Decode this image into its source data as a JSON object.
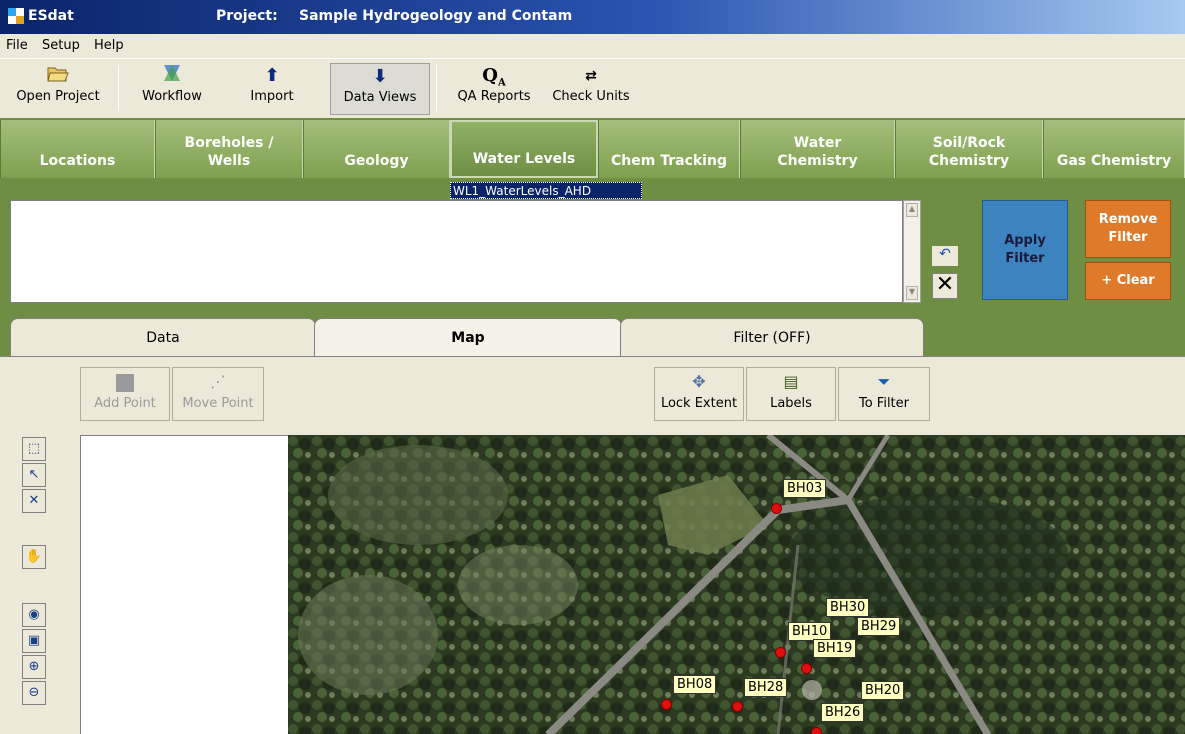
{
  "window": {
    "app_name": "ESdat",
    "project_label": "Project:",
    "project_name": "Sample Hydrogeology and Contam"
  },
  "menu": [
    "File",
    "Setup",
    "Help"
  ],
  "toolbar": [
    {
      "label": "Open Project",
      "icon": "folder-open-icon"
    },
    {
      "label": "Workflow",
      "icon": "workflow-icon"
    },
    {
      "label": "Import",
      "icon": "up-arrow-icon"
    },
    {
      "label": "Data Views",
      "icon": "down-arrow-icon",
      "active": true
    },
    {
      "label": "QA Reports",
      "icon": "qa-icon"
    },
    {
      "label": "Check Units",
      "icon": "units-icon"
    }
  ],
  "modules": [
    {
      "label": "Locations"
    },
    {
      "label": "Boreholes /\nWells"
    },
    {
      "label": "Geology"
    },
    {
      "label": "Water Levels",
      "selected": true
    },
    {
      "label": "Chem Tracking"
    },
    {
      "label": "Water\nChemistry"
    },
    {
      "label": "Soil/Rock\nChemistry"
    },
    {
      "label": "Gas Chemistry"
    }
  ],
  "filter": {
    "view_selected": "WL1_WaterLevels_AHD",
    "text_value": "",
    "apply_label": "Apply\nFilter",
    "remove_label": "Remove\nFilter",
    "clear_label": "+ Clear",
    "clear_x": "✕"
  },
  "lower_tabs": [
    {
      "label": "Data"
    },
    {
      "label": "Map",
      "selected": true
    },
    {
      "label": "Filter (OFF)"
    }
  ],
  "map_toolbar": {
    "add_point": "Add Point",
    "move_point": "Move Point",
    "lock_extent": "Lock Extent",
    "labels": "Labels",
    "to_filter": "To Filter"
  },
  "map_tools": [
    "select-icon",
    "select-point-icon",
    "deselect-icon",
    "pan-hand-icon",
    "globe-icon",
    "full-extent-icon",
    "zoom-in-icon",
    "zoom-out-icon"
  ],
  "boreholes": [
    "BH03",
    "BH30",
    "BH10",
    "BH29",
    "BH19",
    "BH08",
    "BH28",
    "BH20",
    "BH26"
  ],
  "colors": {
    "title_blue": "#0A246A",
    "module_green": "#6E8E44",
    "apply_blue": "#3D83C0",
    "remove_orange": "#DE7A2A",
    "marker_red": "#E01010",
    "label_yellow": "#FFFFC0"
  }
}
